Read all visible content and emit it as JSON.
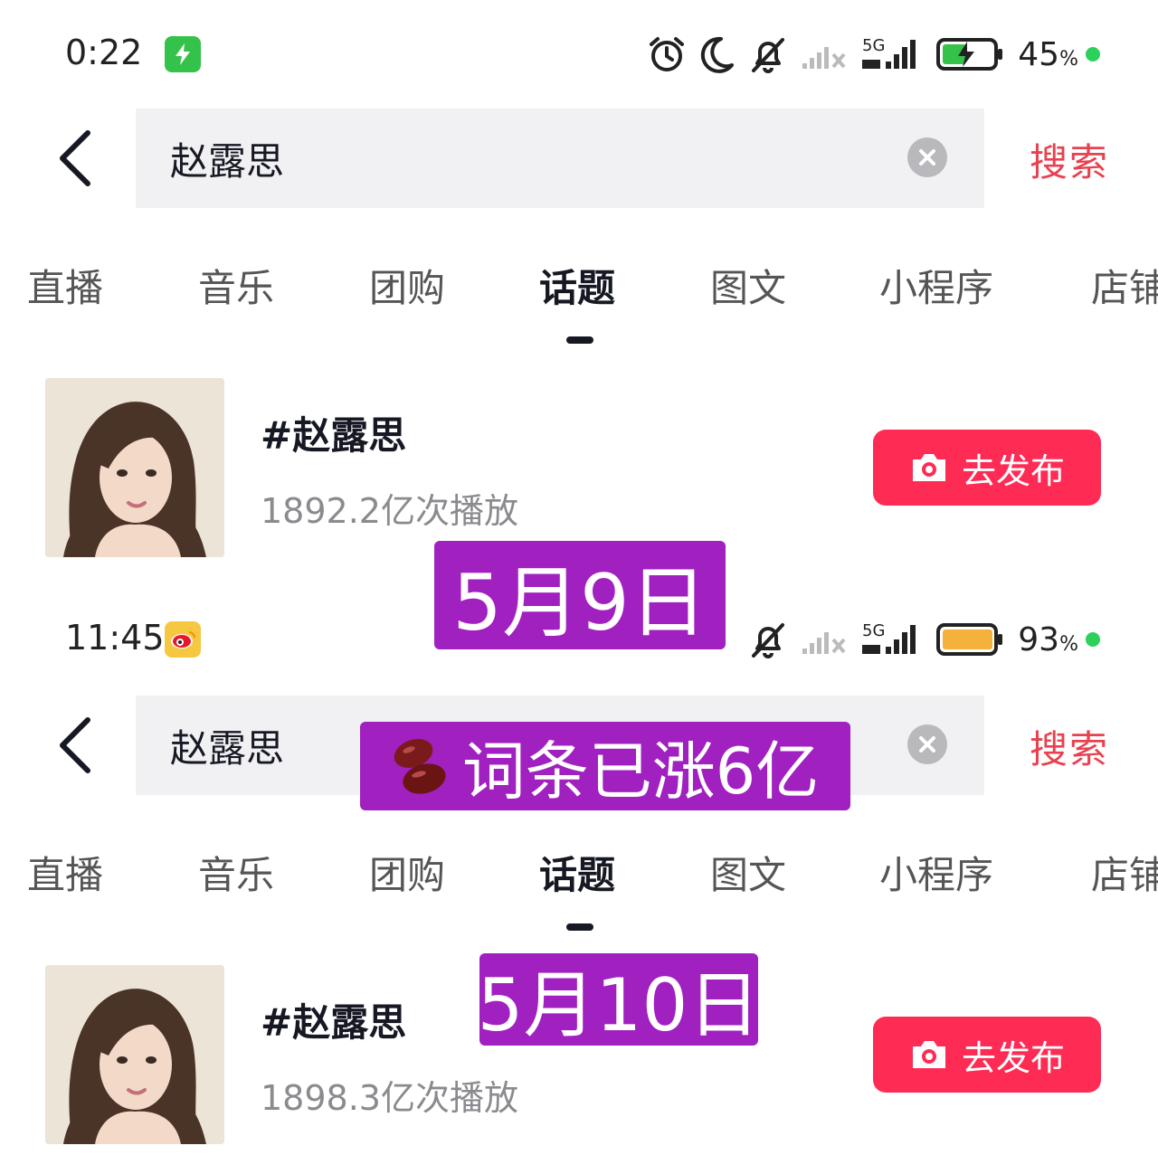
{
  "screens": [
    {
      "status_bar": {
        "time": "0:22",
        "network": "5G",
        "battery": "45",
        "battery_unit": "%"
      },
      "search": {
        "query": "赵露思",
        "submit_label": "搜索"
      },
      "tabs": [
        "直播",
        "音乐",
        "团购",
        "话题",
        "图文",
        "小程序",
        "店铺"
      ],
      "active_tab": "话题",
      "result": {
        "title": "#赵露思",
        "views": "1892.2亿次播放",
        "button_label": "去发布"
      }
    },
    {
      "status_bar": {
        "time": "11:45",
        "network": "5G",
        "battery": "93",
        "battery_unit": "%"
      },
      "search": {
        "query": "赵露思",
        "submit_label": "搜索"
      },
      "tabs": [
        "直播",
        "音乐",
        "团购",
        "话题",
        "图文",
        "小程序",
        "店铺"
      ],
      "active_tab": "话题",
      "result": {
        "title": "#赵露思",
        "views": "1898.3亿次播放",
        "button_label": "去发布"
      }
    }
  ],
  "overlays": {
    "date1": "5月9日",
    "rise": "词条已涨6亿",
    "date2": "5月10日"
  },
  "colors": {
    "accent_red": "#fe2c55",
    "search_red": "#e8414f",
    "overlay_purple": "#a020c0",
    "battery_green": "#35c24a",
    "battery_orange": "#f4b23a"
  },
  "icons": [
    "back-arrow-icon",
    "clear-icon",
    "camera-icon",
    "alarm-icon",
    "moon-icon",
    "mute-bell-icon",
    "signal-icon",
    "battery-icon",
    "bean-emoji-icon"
  ]
}
